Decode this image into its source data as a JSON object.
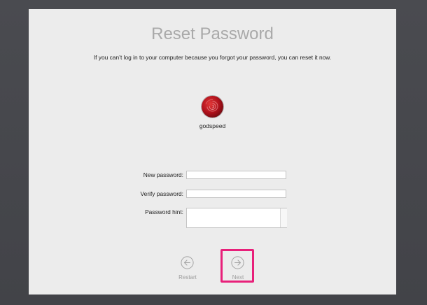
{
  "dialog": {
    "title": "Reset Password",
    "subtitle": "If you can’t log in to your computer because you forgot your password, you can reset it now."
  },
  "user": {
    "name": "godspeed",
    "avatar_icon": "rose-avatar-icon"
  },
  "form": {
    "new_password_label": "New password:",
    "new_password_value": "",
    "verify_password_label": "Verify password:",
    "verify_password_value": "",
    "password_hint_label": "Password hint:",
    "password_hint_value": ""
  },
  "nav": {
    "restart_label": "Restart",
    "restart_icon": "arrow-left-circle-icon",
    "next_label": "Next",
    "next_icon": "arrow-right-circle-icon"
  },
  "colors": {
    "background": "#45464b",
    "panel": "#ececec",
    "title": "#a9a9a9",
    "highlight": "#e8207a",
    "avatar": "#b3121c"
  }
}
